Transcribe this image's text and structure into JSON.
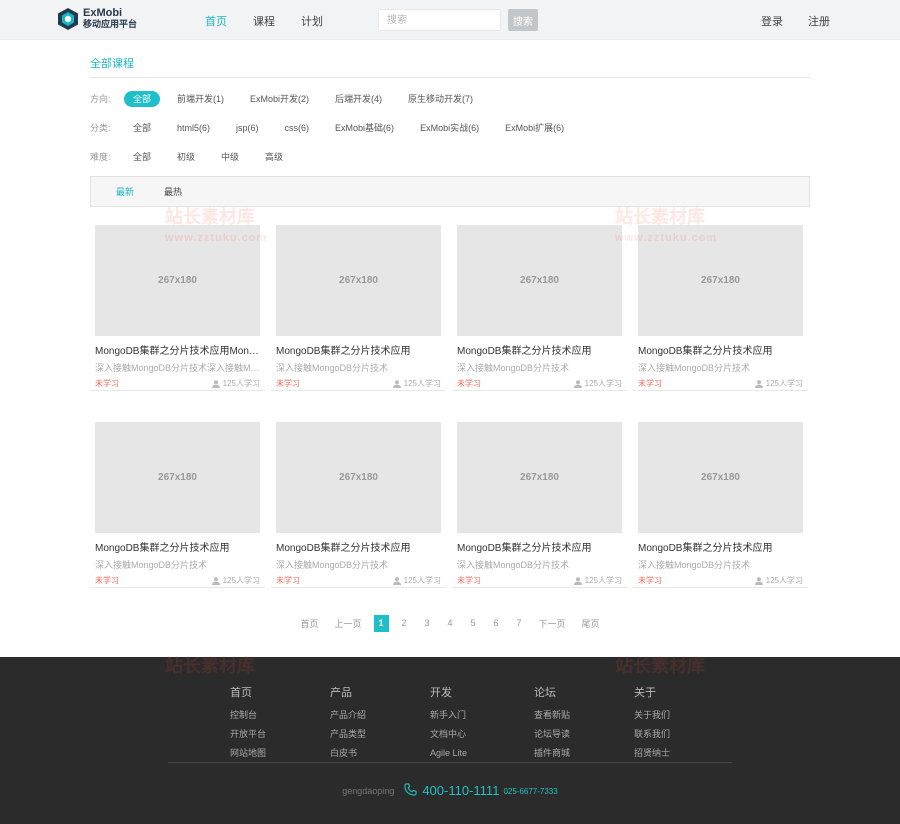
{
  "header": {
    "logo_title": "ExMobi",
    "logo_subtitle": "移动应用平台",
    "nav": [
      {
        "label": "首页",
        "active": true
      },
      {
        "label": "课程",
        "active": false
      },
      {
        "label": "计划",
        "active": false
      }
    ],
    "search_placeholder": "搜索",
    "search_button": "搜索",
    "login": "登录",
    "register": "注册"
  },
  "breadcrumb": "全部课程",
  "filters": [
    {
      "label": "方向:",
      "options": [
        "全部",
        "前端开发(1)",
        "ExMobi开发(2)",
        "后端开发(4)",
        "原生移动开发(7)"
      ],
      "active": 0
    },
    {
      "label": "分类:",
      "options": [
        "全部",
        "html5(6)",
        "jsp(6)",
        "css(6)",
        "ExMobi基础(6)",
        "ExMobi实战(6)",
        "ExMobi扩展(6)"
      ],
      "active": -1
    },
    {
      "label": "难度:",
      "options": [
        "全部",
        "初级",
        "中级",
        "高级"
      ],
      "active": -1
    }
  ],
  "sort": {
    "newest": "最新",
    "hottest": "最热"
  },
  "courses": [
    {
      "thumb": "267x180",
      "title": "MongoDB集群之分片技术应用MongoDB集群之分片技术应用",
      "desc": "深入接触MongoDB分片技术深入接触MongoDB分片技术",
      "status": "未学习",
      "count": "125人学习"
    },
    {
      "thumb": "267x180",
      "title": "MongoDB集群之分片技术应用",
      "desc": "深入接触MongoDB分片技术",
      "status": "未学习",
      "count": "125人学习"
    },
    {
      "thumb": "267x180",
      "title": "MongoDB集群之分片技术应用",
      "desc": "深入接触MongoDB分片技术",
      "status": "未学习",
      "count": "125人学习"
    },
    {
      "thumb": "267x180",
      "title": "MongoDB集群之分片技术应用",
      "desc": "深入接触MongoDB分片技术",
      "status": "未学习",
      "count": "125人学习"
    },
    {
      "thumb": "267x180",
      "title": "MongoDB集群之分片技术应用",
      "desc": "深入接触MongoDB分片技术",
      "status": "未学习",
      "count": "125人学习"
    },
    {
      "thumb": "267x180",
      "title": "MongoDB集群之分片技术应用",
      "desc": "深入接触MongoDB分片技术",
      "status": "未学习",
      "count": "125人学习"
    },
    {
      "thumb": "267x180",
      "title": "MongoDB集群之分片技术应用",
      "desc": "深入接触MongoDB分片技术",
      "status": "未学习",
      "count": "125人学习"
    },
    {
      "thumb": "267x180",
      "title": "MongoDB集群之分片技术应用",
      "desc": "深入接触MongoDB分片技术",
      "status": "未学习",
      "count": "125人学习"
    }
  ],
  "pagination": {
    "first": "首页",
    "prev": "上一页",
    "pages": [
      "1",
      "2",
      "3",
      "4",
      "5",
      "6",
      "7"
    ],
    "current": 0,
    "next": "下一页",
    "last": "尾页"
  },
  "footer": {
    "columns": [
      {
        "title": "首页",
        "links": [
          "控制台",
          "开放平台",
          "网站地图"
        ]
      },
      {
        "title": "产品",
        "links": [
          "产品介绍",
          "产品类型",
          "白皮书"
        ]
      },
      {
        "title": "开发",
        "links": [
          "新手入门",
          "文档中心",
          "Agile Lite"
        ]
      },
      {
        "title": "论坛",
        "links": [
          "查看新贴",
          "论坛导读",
          "插件商城"
        ]
      },
      {
        "title": "关于",
        "links": [
          "关于我们",
          "联系我们",
          "招贤纳士"
        ]
      }
    ],
    "username": "gengdaoping",
    "phone_main": "400-110-1111",
    "phone_alt": "025-6677-7333"
  },
  "watermark": {
    "text": "站长素材库",
    "url": "www.zztuku.com"
  },
  "colors": {
    "accent": "#1fbfc9",
    "status": "#f26b5b",
    "footer_bg": "#2b2b2b"
  }
}
